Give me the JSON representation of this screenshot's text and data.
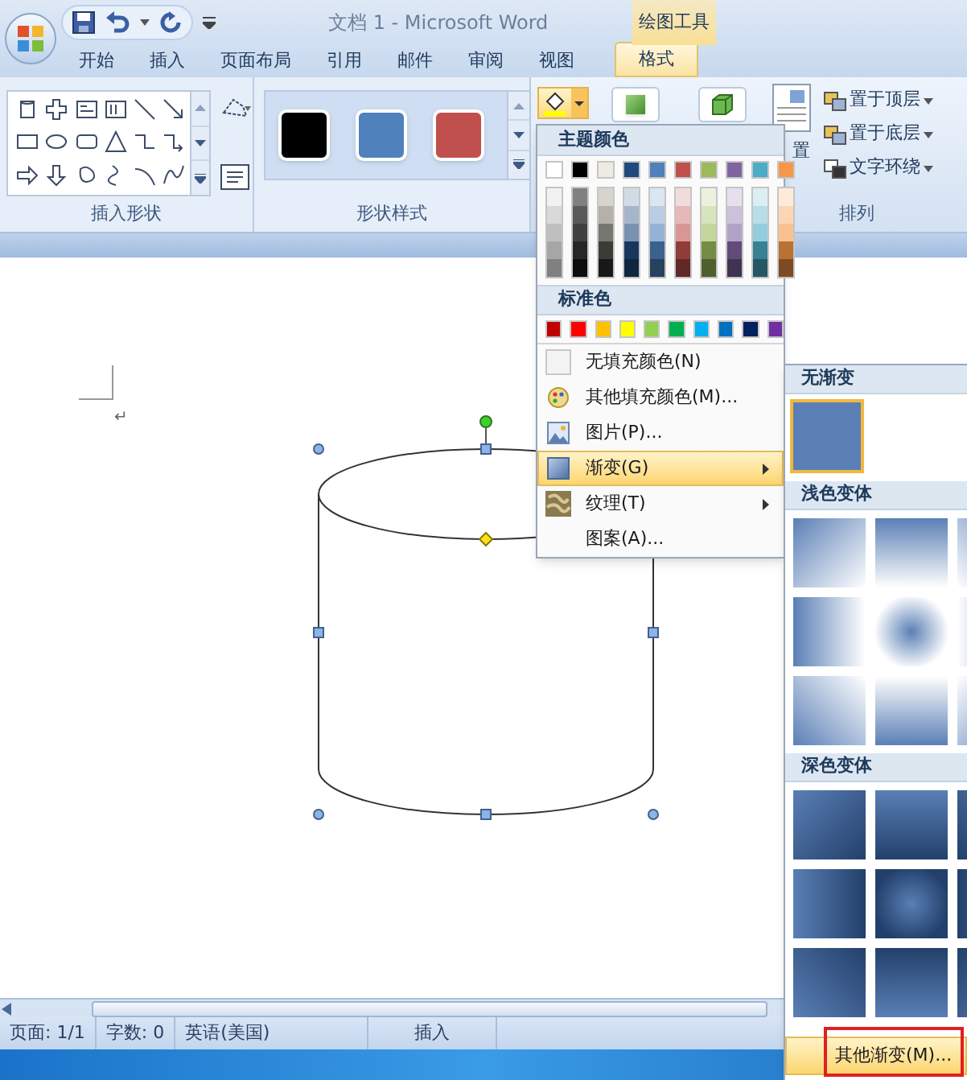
{
  "window": {
    "title": "文档 1 - Microsoft Word",
    "context_label": "绘图工具"
  },
  "tabs": [
    {
      "label": "开始",
      "selected": false
    },
    {
      "label": "插入",
      "selected": false
    },
    {
      "label": "页面布局",
      "selected": false
    },
    {
      "label": "引用",
      "selected": false
    },
    {
      "label": "邮件",
      "selected": false
    },
    {
      "label": "审阅",
      "selected": false
    },
    {
      "label": "视图",
      "selected": false
    },
    {
      "label": "格式",
      "selected": true
    }
  ],
  "ribbon": {
    "groups": [
      {
        "label": "插入形状"
      },
      {
        "label": "形状样式"
      },
      {
        "label": "排列"
      }
    ],
    "style_swatches": [
      {
        "color": "#000000"
      },
      {
        "color": "#4f81bd"
      },
      {
        "color": "#c0504d"
      }
    ],
    "position_label": "置",
    "arrange_items": [
      {
        "label": "置于顶层"
      },
      {
        "label": "置于底层"
      },
      {
        "label": "文字环绕"
      }
    ]
  },
  "document": {
    "paragraph_mark": "↵"
  },
  "fill_menu": {
    "theme_header": "主题颜色",
    "theme_colors": [
      {
        "color": "#ffffff"
      },
      {
        "color": "#000000"
      },
      {
        "color": "#eeece1"
      },
      {
        "color": "#1f497d"
      },
      {
        "color": "#4f81bd"
      },
      {
        "color": "#c0504d"
      },
      {
        "color": "#9bbb59"
      },
      {
        "color": "#8064a2"
      },
      {
        "color": "#4bacc6"
      },
      {
        "color": "#f79646"
      }
    ],
    "standard_header": "标准色",
    "standard_colors": [
      {
        "color": "#c00000"
      },
      {
        "color": "#ff0000"
      },
      {
        "color": "#ffc000"
      },
      {
        "color": "#ffff00"
      },
      {
        "color": "#92d050"
      },
      {
        "color": "#00b050"
      },
      {
        "color": "#00b0f0"
      },
      {
        "color": "#0070c0"
      },
      {
        "color": "#002060"
      },
      {
        "color": "#7030a0"
      }
    ],
    "items": [
      {
        "kind": "no-fill",
        "label": "无填充颜色(N)",
        "selected": false,
        "submenu": false
      },
      {
        "kind": "palette",
        "label": "其他填充颜色(M)...",
        "selected": false,
        "submenu": false
      },
      {
        "kind": "picture",
        "label": "图片(P)...",
        "selected": false,
        "submenu": false
      },
      {
        "kind": "gradient",
        "label": "渐变(G)",
        "selected": true,
        "submenu": true
      },
      {
        "kind": "texture",
        "label": "纹理(T)",
        "selected": false,
        "submenu": true
      },
      {
        "kind": "pattern",
        "label": "图案(A)...",
        "selected": false,
        "submenu": false
      }
    ]
  },
  "gradient_menu": {
    "sections": [
      {
        "title": "无渐变",
        "kind": "single",
        "tiles": [
          {
            "selected": true
          }
        ]
      },
      {
        "title": "浅色变体",
        "kind": "light",
        "tiles": [
          {
            "selected": false
          },
          {
            "selected": false
          },
          {
            "selected": false
          },
          {
            "selected": false
          },
          {
            "selected": false
          },
          {
            "selected": false
          },
          {
            "selected": false
          },
          {
            "selected": false
          },
          {
            "selected": false
          }
        ]
      },
      {
        "title": "深色变体",
        "kind": "dark",
        "tiles": [
          {
            "selected": false
          },
          {
            "selected": false
          },
          {
            "selected": false
          },
          {
            "selected": false
          },
          {
            "selected": false
          },
          {
            "selected": false
          },
          {
            "selected": false
          },
          {
            "selected": false
          },
          {
            "selected": false
          }
        ]
      }
    ],
    "footer": {
      "label": "其他渐变(M)...",
      "selected": true
    }
  },
  "status_bar": [
    "页面: 1/1",
    "字数: 0",
    "英语(美国)",
    "插入"
  ]
}
